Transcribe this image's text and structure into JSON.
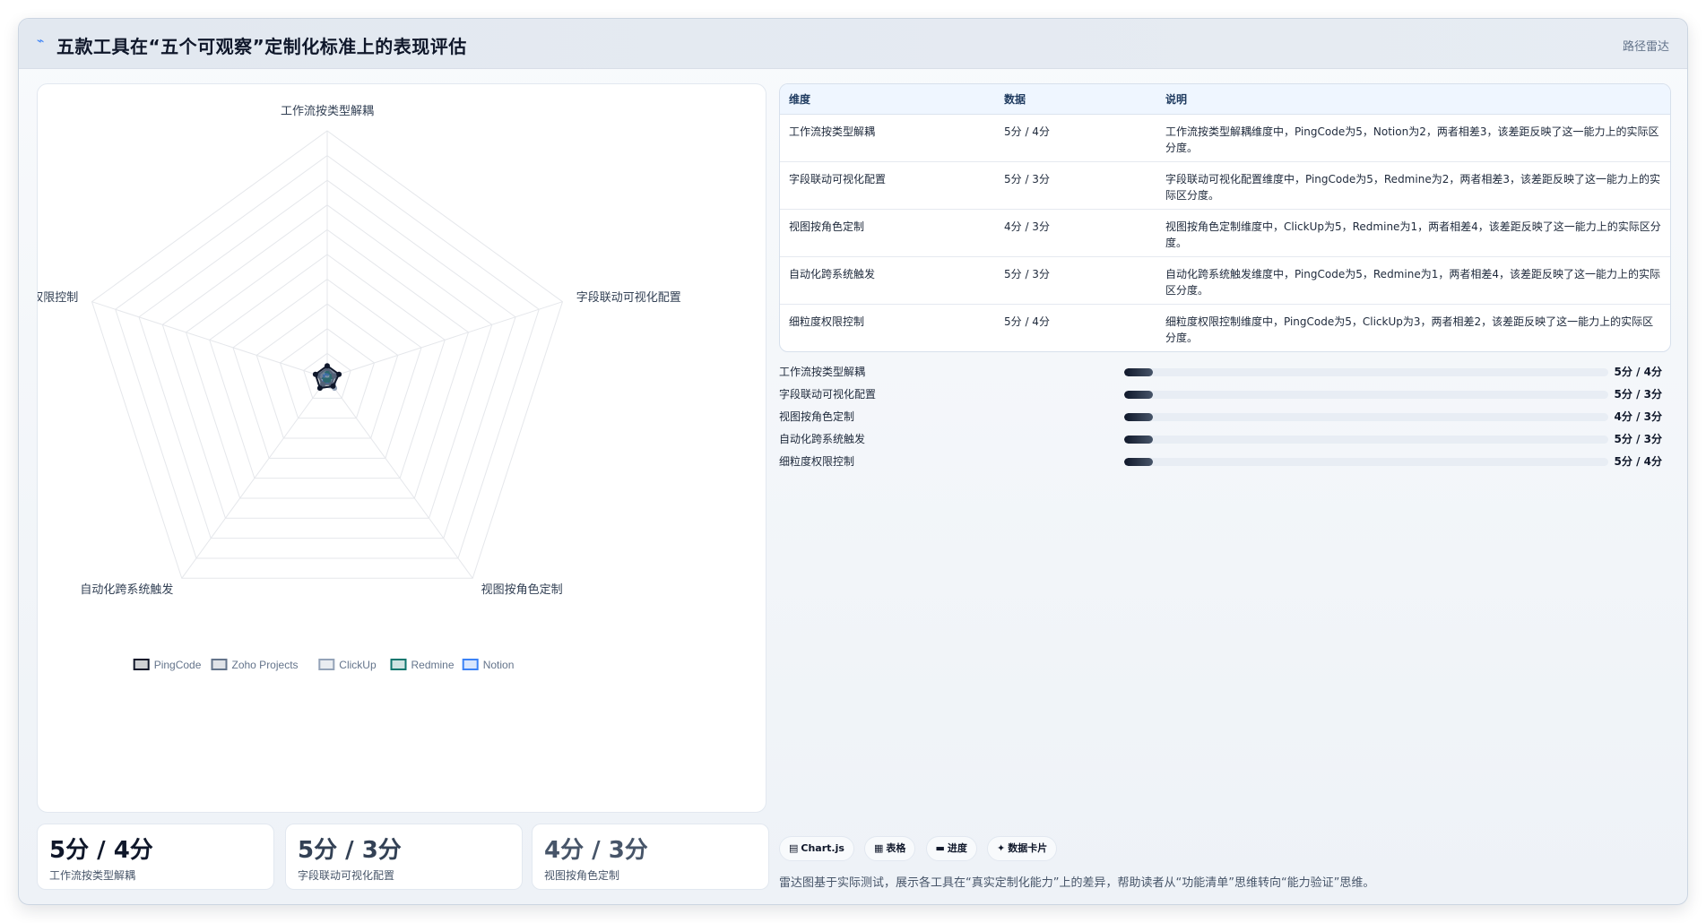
{
  "header": {
    "title": "五款工具在“五个可观察”定制化标准上的表现评估",
    "tag": "路径雷达"
  },
  "chart_data": {
    "type": "radar",
    "axes": [
      "工作流按类型解耦",
      "字段联动可视化配置",
      "视图按角色定制",
      "自动化跨系统触发",
      "细粒度权限控制"
    ],
    "series": [
      {
        "name": "PingCode",
        "values": [
          5,
          5,
          4,
          5,
          5
        ],
        "color": "#0f172a"
      },
      {
        "name": "Zoho Projects",
        "values": [
          4,
          3,
          3,
          3,
          4
        ],
        "color": "#64748b"
      },
      {
        "name": "ClickUp",
        "values": [
          4,
          4,
          5,
          4,
          3
        ],
        "color": "#94a3b8"
      },
      {
        "name": "Redmine",
        "values": [
          3,
          2,
          1,
          1,
          4
        ],
        "color": "#0f766e"
      },
      {
        "name": "Notion",
        "values": [
          2,
          3,
          3,
          2,
          2
        ],
        "color": "#3b82f6"
      }
    ],
    "rmax": 100,
    "grid_levels": 10,
    "legend": "bottom"
  },
  "table": {
    "headers": [
      "维度",
      "数据",
      "说明"
    ],
    "rows": [
      {
        "dim": "工作流按类型解耦",
        "data": "5分 / 4分",
        "desc": "工作流按类型解耦维度中，PingCode为5，Notion为2，两者相差3，该差距反映了这一能力上的实际区分度。"
      },
      {
        "dim": "字段联动可视化配置",
        "data": "5分 / 3分",
        "desc": "字段联动可视化配置维度中，PingCode为5，Redmine为2，两者相差3，该差距反映了这一能力上的实际区分度。"
      },
      {
        "dim": "视图按角色定制",
        "data": "4分 / 3分",
        "desc": "视图按角色定制维度中，ClickUp为5，Redmine为1，两者相差4，该差距反映了这一能力上的实际区分度。"
      },
      {
        "dim": "自动化跨系统触发",
        "data": "5分 / 3分",
        "desc": "自动化跨系统触发维度中，PingCode为5，Redmine为1，两者相差4，该差距反映了这一能力上的实际区分度。"
      },
      {
        "dim": "细粒度权限控制",
        "data": "5分 / 4分",
        "desc": "细粒度权限控制维度中，PingCode为5，ClickUp为3，两者相差2，该差距反映了这一能力上的实际区分度。"
      }
    ]
  },
  "progress": [
    {
      "label": "工作流按类型解耦",
      "value": "5分 / 4分",
      "fraction": 0.06
    },
    {
      "label": "字段联动可视化配置",
      "value": "5分 / 3分",
      "fraction": 0.06
    },
    {
      "label": "视图按角色定制",
      "value": "4分 / 3分",
      "fraction": 0.06
    },
    {
      "label": "自动化跨系统触发",
      "value": "5分 / 3分",
      "fraction": 0.06
    },
    {
      "label": "细粒度权限控制",
      "value": "5分 / 4分",
      "fraction": 0.06
    }
  ],
  "stats": [
    {
      "value": "5分 / 4分",
      "label": "工作流按类型解耦",
      "color": "#0f172a"
    },
    {
      "value": "5分 / 3分",
      "label": "字段联动可视化配置",
      "color": "#334155"
    },
    {
      "value": "4分 / 3分",
      "label": "视图按角色定制",
      "color": "#475569"
    }
  ],
  "chips": [
    {
      "icon": "▤",
      "icon_name": "chart-icon",
      "label": "Chart.js"
    },
    {
      "icon": "▦",
      "icon_name": "table-icon",
      "label": "表格"
    },
    {
      "icon": "▬",
      "icon_name": "progress-icon",
      "label": "进度"
    },
    {
      "icon": "✦",
      "icon_name": "card-icon",
      "label": "数据卡片"
    }
  ],
  "footnote": "雷达图基于实际测试，展示各工具在“真实定制化能力”上的差异，帮助读者从“功能清单”思维转向“能力验证”思维。"
}
